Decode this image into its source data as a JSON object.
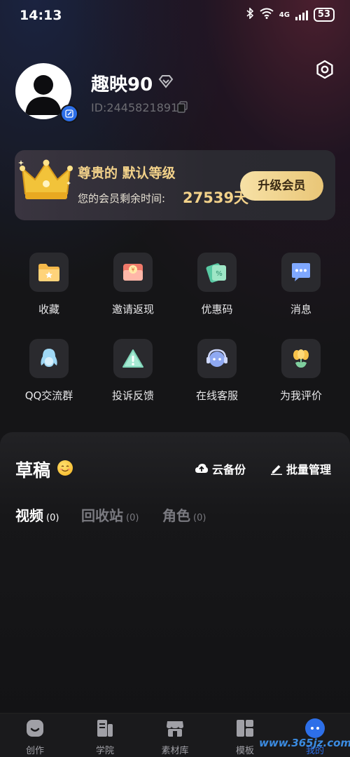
{
  "status_bar": {
    "time": "14:13",
    "network": "4G",
    "battery": "53"
  },
  "profile": {
    "username": "趣映90",
    "user_id": "ID:2445821891"
  },
  "vip_card": {
    "title": "尊贵的 默认等级",
    "remaining_label": "您的会员剩余时间:",
    "remaining_days": "27539天",
    "upgrade_label": "升级会员"
  },
  "grid": [
    {
      "label": "收藏",
      "icon": "folder-icon"
    },
    {
      "label": "邀请返现",
      "icon": "red-envelope-icon"
    },
    {
      "label": "优惠码",
      "icon": "coupon-icon"
    },
    {
      "label": "消息",
      "icon": "message-icon"
    },
    {
      "label": "QQ交流群",
      "icon": "penguin-icon"
    },
    {
      "label": "投诉反馈",
      "icon": "warning-icon"
    },
    {
      "label": "在线客服",
      "icon": "headset-icon"
    },
    {
      "label": "为我评价",
      "icon": "flower-icon"
    }
  ],
  "drafts": {
    "title": "草稿",
    "cloud_backup": "云备份",
    "batch_manage": "批量管理",
    "tabs": [
      {
        "label": "视频",
        "count": "(0)",
        "active": true
      },
      {
        "label": "回收站",
        "count": "(0)",
        "active": false
      },
      {
        "label": "角色",
        "count": "(0)",
        "active": false
      }
    ]
  },
  "bottom_nav": [
    {
      "label": "创作",
      "icon": "create-icon"
    },
    {
      "label": "学院",
      "icon": "academy-icon"
    },
    {
      "label": "素材库",
      "icon": "store-icon"
    },
    {
      "label": "模板",
      "icon": "template-icon"
    },
    {
      "label": "我的",
      "icon": "profile-icon",
      "active": true
    }
  ],
  "watermark": "www.365jz.com",
  "colors": {
    "gold": "#f3d28a",
    "accent_blue": "#2d6fe8",
    "background": "#121214"
  }
}
